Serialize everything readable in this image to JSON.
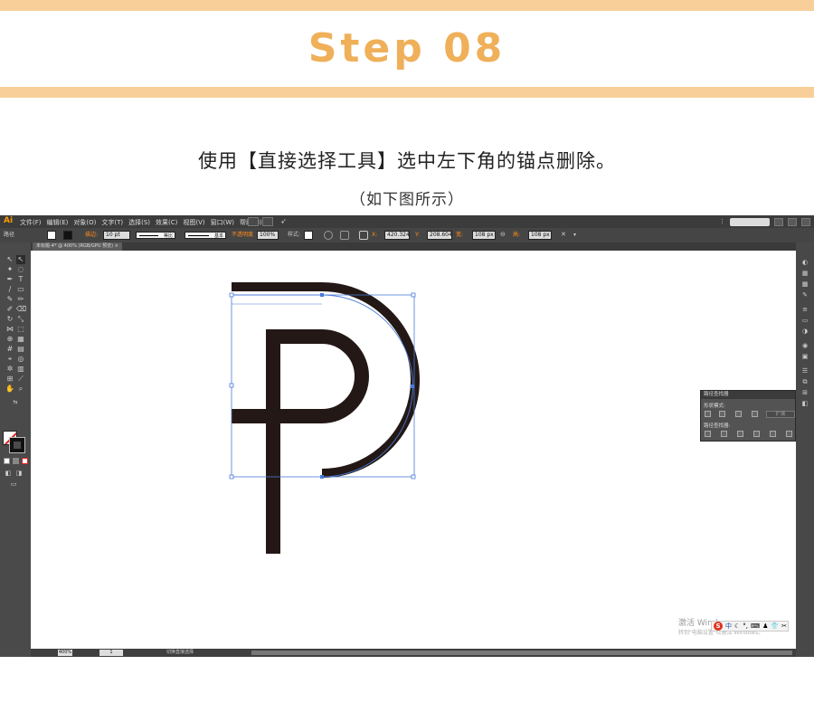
{
  "tutorial": {
    "step_title": "Step 08",
    "instruction": "使用【直接选择工具】选中左下角的锚点删除。",
    "sub_instruction": "（如下图所示）"
  },
  "app": {
    "logo": "Ai",
    "menu": [
      "文件(F)",
      "编辑(E)",
      "对象(O)",
      "文字(T)",
      "选择(S)",
      "效果(C)",
      "视图(V)",
      "窗口(W)",
      "帮助(H)"
    ]
  },
  "control_bar": {
    "selection_type": "路径",
    "stroke_label": "描边:",
    "stroke_weight": "10 pt",
    "stroke_profile": "等比",
    "brush": "基本",
    "opacity_label": "不透明度",
    "opacity": "100%",
    "style_label": "样式:",
    "x_label": "X:",
    "x_value": "420.324",
    "y_label": "Y:",
    "y_value": "208.604",
    "w_label": "宽:",
    "w_value": "108 px",
    "h_label": "高:",
    "h_value": "108 px"
  },
  "document": {
    "tab_title": "未标题-4* @ 400% (RGB/GPU 预览)",
    "zoom": "400%",
    "page": "1",
    "status_text": "切换直接选择"
  },
  "pathfinder": {
    "title": "路径查找器",
    "shape_modes_label": "形状模式:",
    "expand_label": "扩展",
    "pathfinders_label": "路径查找器:"
  },
  "watermark": {
    "line1": "激活 Windows",
    "line2": "转到\"电脑设置\"以激活 Windows。"
  },
  "ime": {
    "logo": "S",
    "chars": "中"
  },
  "colors": {
    "accent_orange": "#efb059",
    "band": "#f8cf99",
    "artwork": "#231815",
    "selection": "#4a7bd8"
  }
}
